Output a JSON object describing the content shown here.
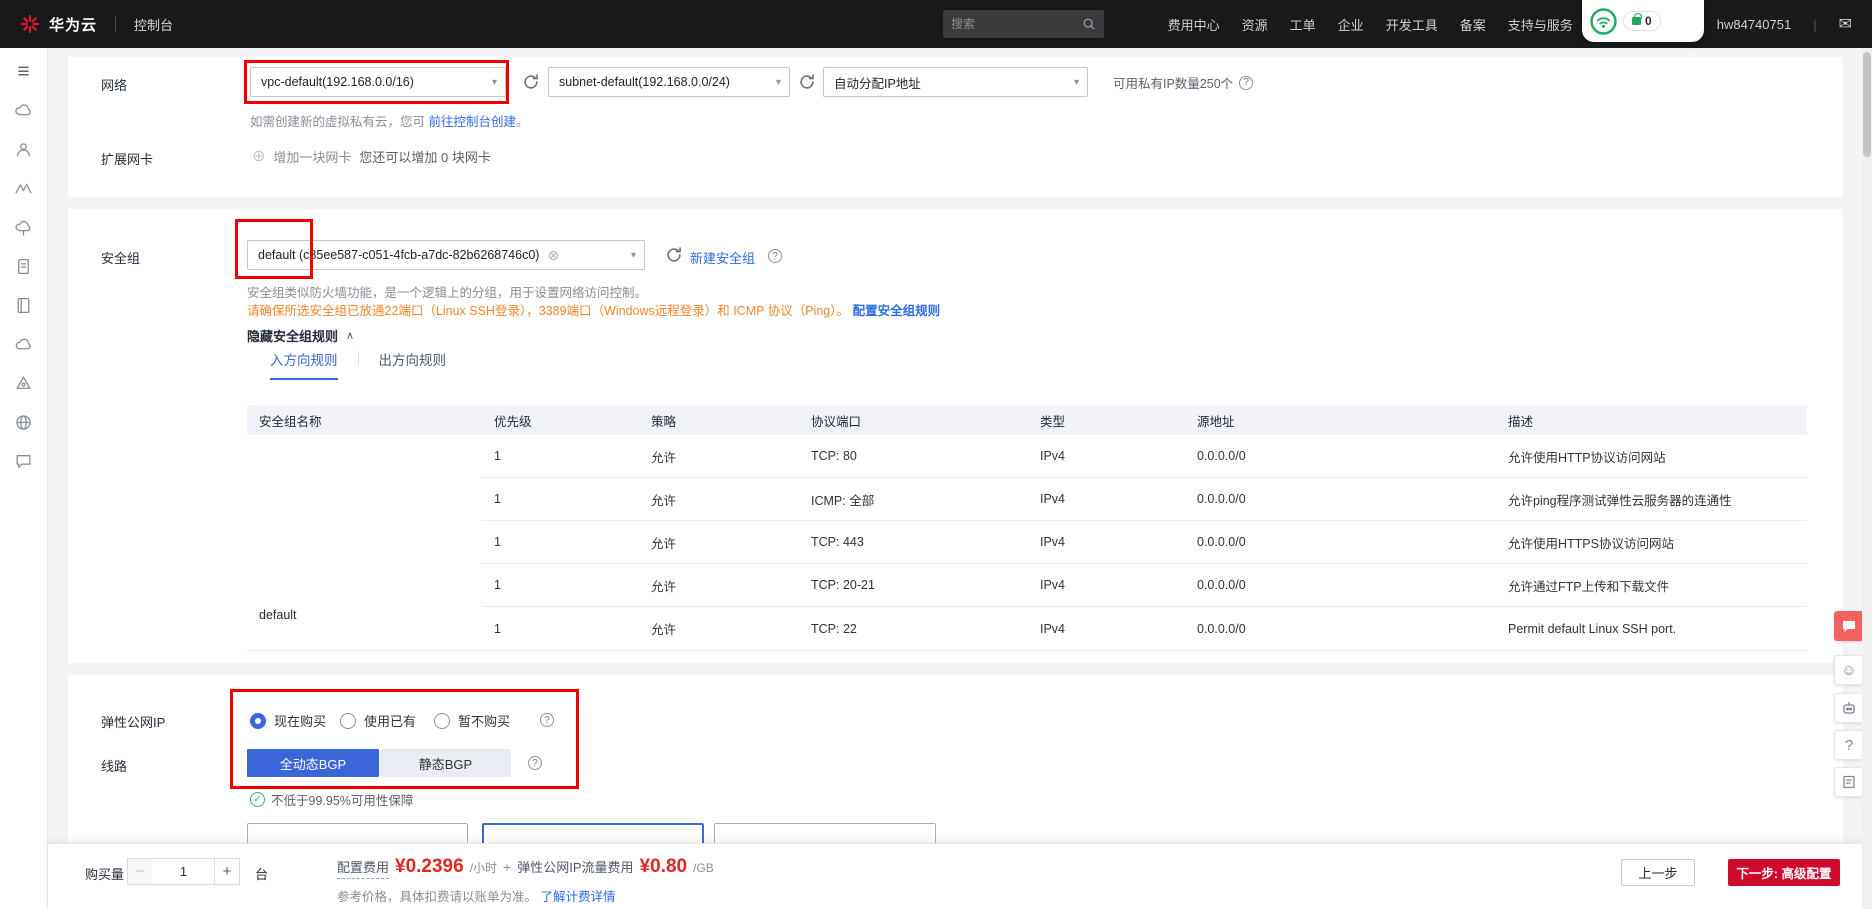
{
  "colors": {
    "accent_blue": "#3a66d9",
    "link_blue": "#2f6ce6",
    "price_red": "#e0271f",
    "warning_orange": "#f0862c",
    "annotation_red": "#ee0000",
    "button_red": "#cf0a2c",
    "brand_red": "#e8102d",
    "success_green": "#3bb36a"
  },
  "icons": {
    "menu": "≡",
    "dropdown_arrow": "▾",
    "collapse_arrow": "∧",
    "plus_circle": "⊕",
    "remove_tag": "⊗",
    "mail": "✉",
    "check": "✓",
    "question": "?",
    "smiley": "☺",
    "minus": "−",
    "plus": "+",
    "pipe": "|"
  },
  "navbar": {
    "logo_text": "华为云",
    "console_label": "控制台",
    "search_placeholder": "搜索",
    "menu": [
      "费用中心",
      "资源",
      "工单",
      "企业",
      "开发工具",
      "备案",
      "支持与服务"
    ],
    "username": "hw84740751",
    "overlay_badge": "0"
  },
  "sidebar": {
    "icons": [
      "menu",
      "cloud-server",
      "user",
      "network",
      "cloud-service",
      "document",
      "notebook",
      "cloud",
      "deployment",
      "globe",
      "support-chat"
    ]
  },
  "network": {
    "label": "网络",
    "vpc_value": "vpc-default(192.168.0.0/16)",
    "subnet_value": "subnet-default(192.168.0.0/24)",
    "ip_mode_value": "自动分配IP地址",
    "available_ip": "可用私有IP数量250个",
    "create_hint_prefix": "如需创建新的虚拟私有云，您可",
    "create_link": "前往控制台创建",
    "create_hint_suffix": "。",
    "nic_label": "扩展网卡",
    "add_nic": "增加一块网卡",
    "nic_hint": "您还可以增加 0 块网卡"
  },
  "security": {
    "label": "安全组",
    "sg_value": "default (c85ee587-c051-4fcb-a7dc-82b6268746c0)",
    "new_sg_link": "新建安全组",
    "desc": "安全组类似防火墙功能，是一个逻辑上的分组，用于设置网络访问控制。",
    "warning": "请确保所选安全组已放通22端口（Linux SSH登录），3389端口（Windows远程登录）和 ICMP 协议（Ping）。",
    "config_rule_link": "配置安全组规则",
    "hide_rules": "隐藏安全组规则",
    "tabs": [
      "入方向规则",
      "出方向规则"
    ],
    "table": {
      "headers": [
        "安全组名称",
        "优先级",
        "策略",
        "协议端口",
        "类型",
        "源地址",
        "描述"
      ],
      "group_name": "default",
      "rows": [
        [
          "1",
          "允许",
          "TCP: 80",
          "IPv4",
          "0.0.0.0/0",
          "允许使用HTTP协议访问网站"
        ],
        [
          "1",
          "允许",
          "ICMP: 全部",
          "IPv4",
          "0.0.0.0/0",
          "允许ping程序测试弹性云服务器的连通性"
        ],
        [
          "1",
          "允许",
          "TCP: 443",
          "IPv4",
          "0.0.0.0/0",
          "允许使用HTTPS协议访问网站"
        ],
        [
          "1",
          "允许",
          "TCP: 20-21",
          "IPv4",
          "0.0.0.0/0",
          "允许通过FTP上传和下载文件"
        ],
        [
          "1",
          "允许",
          "TCP: 22",
          "IPv4",
          "0.0.0.0/0",
          "Permit default Linux SSH port."
        ]
      ]
    }
  },
  "eip": {
    "label": "弹性公网IP",
    "options": [
      "现在购买",
      "使用已有",
      "暂不购买"
    ],
    "selected_option": "现在购买",
    "line_label": "线路",
    "line_options": [
      "全动态BGP",
      "静态BGP"
    ],
    "selected_line": "全动态BGP",
    "sla": "不低于99.95%可用性保障"
  },
  "footer": {
    "quantity_label": "购买量",
    "quantity": "1",
    "unit": "台",
    "config_fee_label": "配置费用",
    "config_fee": "¥0.2396",
    "config_fee_unit": "/小时",
    "plus_sign": "+",
    "traffic_fee_label": "弹性公网IP流量费用",
    "traffic_fee": "¥0.80",
    "traffic_fee_unit": "/GB",
    "price_note": "参考价格，具体扣费请以账单为准。",
    "price_link": "了解计费详情",
    "prev_button": "上一步",
    "next_button": "下一步: 高级配置"
  },
  "toolbar": {
    "icons": [
      "feedback-chat",
      "satisfaction",
      "self-service",
      "help",
      "survey"
    ]
  }
}
